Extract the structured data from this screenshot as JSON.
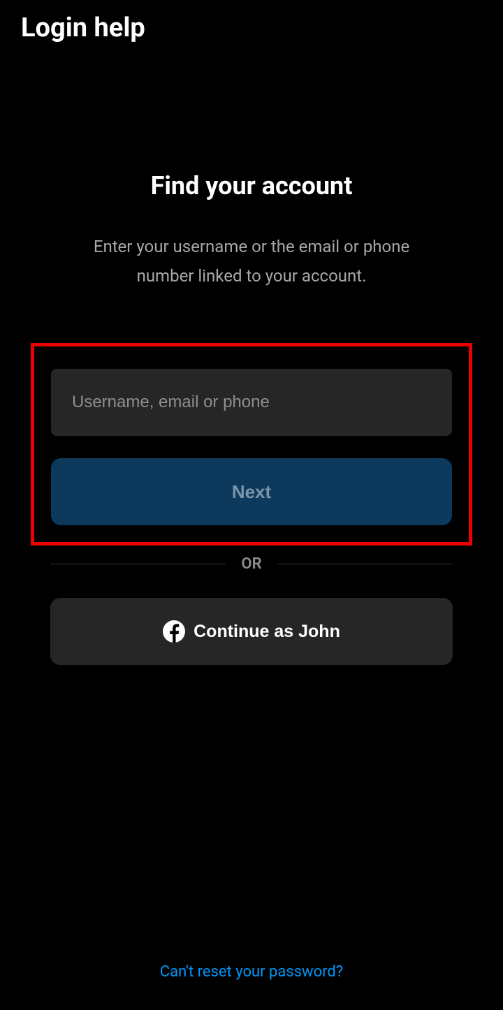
{
  "header": {
    "title": "Login help"
  },
  "main": {
    "title": "Find your account",
    "description": "Enter your username or the email or phone number linked to your account."
  },
  "form": {
    "input_placeholder": "Username, email or phone",
    "next_label": "Next"
  },
  "divider": {
    "text": "OR"
  },
  "social": {
    "facebook_label": "Continue as John"
  },
  "footer": {
    "reset_link": "Can't reset your password?"
  }
}
